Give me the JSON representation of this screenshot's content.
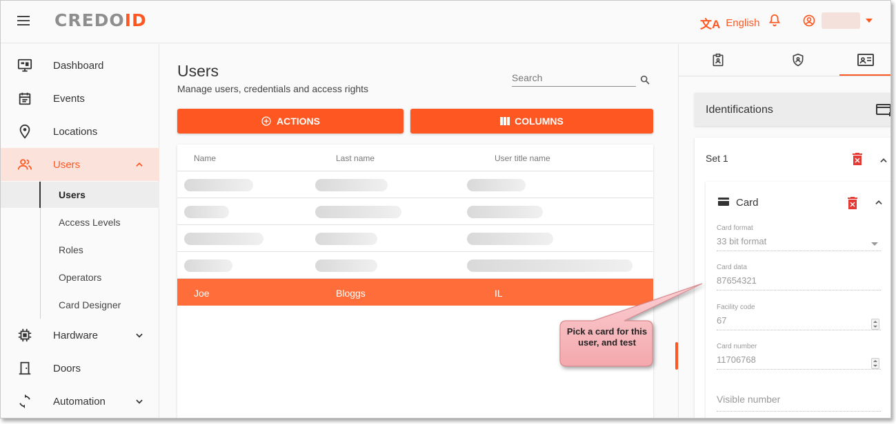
{
  "header": {
    "logo_part1": "CREDO",
    "logo_part2": "ID",
    "language": "English"
  },
  "sidebar": {
    "items": [
      {
        "label": "Dashboard",
        "icon": "monitor-icon"
      },
      {
        "label": "Events",
        "icon": "calendar-icon"
      },
      {
        "label": "Locations",
        "icon": "location-pin-icon"
      },
      {
        "label": "Users",
        "icon": "users-icon",
        "active": true
      },
      {
        "label": "Hardware",
        "icon": "chip-icon"
      },
      {
        "label": "Doors",
        "icon": "door-icon"
      },
      {
        "label": "Automation",
        "icon": "sync-icon"
      }
    ],
    "users_sub": [
      "Users",
      "Access Levels",
      "Roles",
      "Operators",
      "Card Designer"
    ]
  },
  "main": {
    "title": "Users",
    "subtitle": "Manage users, credentials and access rights",
    "search_placeholder": "Search",
    "actions_label": "ACTIONS",
    "columns_label": "COLUMNS",
    "table": {
      "headers": [
        "Name",
        "Last name",
        "User title name"
      ],
      "selected_row": {
        "name": "Joe",
        "last_name": "Bloggs",
        "title": "IL"
      }
    }
  },
  "right_panel": {
    "identifications_title": "Identifications",
    "set_title": "Set 1",
    "card_title": "Card",
    "card_format_label": "Card format",
    "card_format_value": "33 bit format",
    "card_data_label": "Card data",
    "card_data_value": "87654321",
    "facility_code_label": "Facility code",
    "facility_code_value": "67",
    "card_number_label": "Card number",
    "card_number_value": "11706768",
    "visible_number_placeholder": "Visible number"
  },
  "callout": {
    "text": "Pick a card for this user, and test"
  },
  "colors": {
    "accent": "#ff5722",
    "selected_row": "#ff6d3a",
    "callout_fill": "#f7b8bc"
  }
}
